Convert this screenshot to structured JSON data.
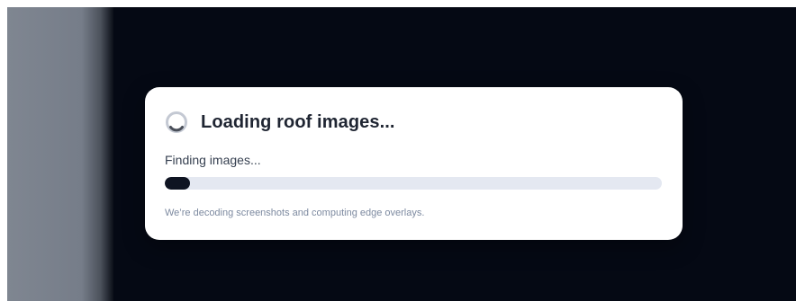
{
  "loader": {
    "title": "Loading roof images...",
    "status": "Finding images...",
    "progress": 0.05,
    "hint": "We’re decoding screenshots and computing edge overlays.",
    "spinner_icon": "spinner-icon"
  },
  "colors": {
    "backdrop": "#050914",
    "progress_fill": "#0f1422",
    "progress_track": "#e4e8f1"
  }
}
